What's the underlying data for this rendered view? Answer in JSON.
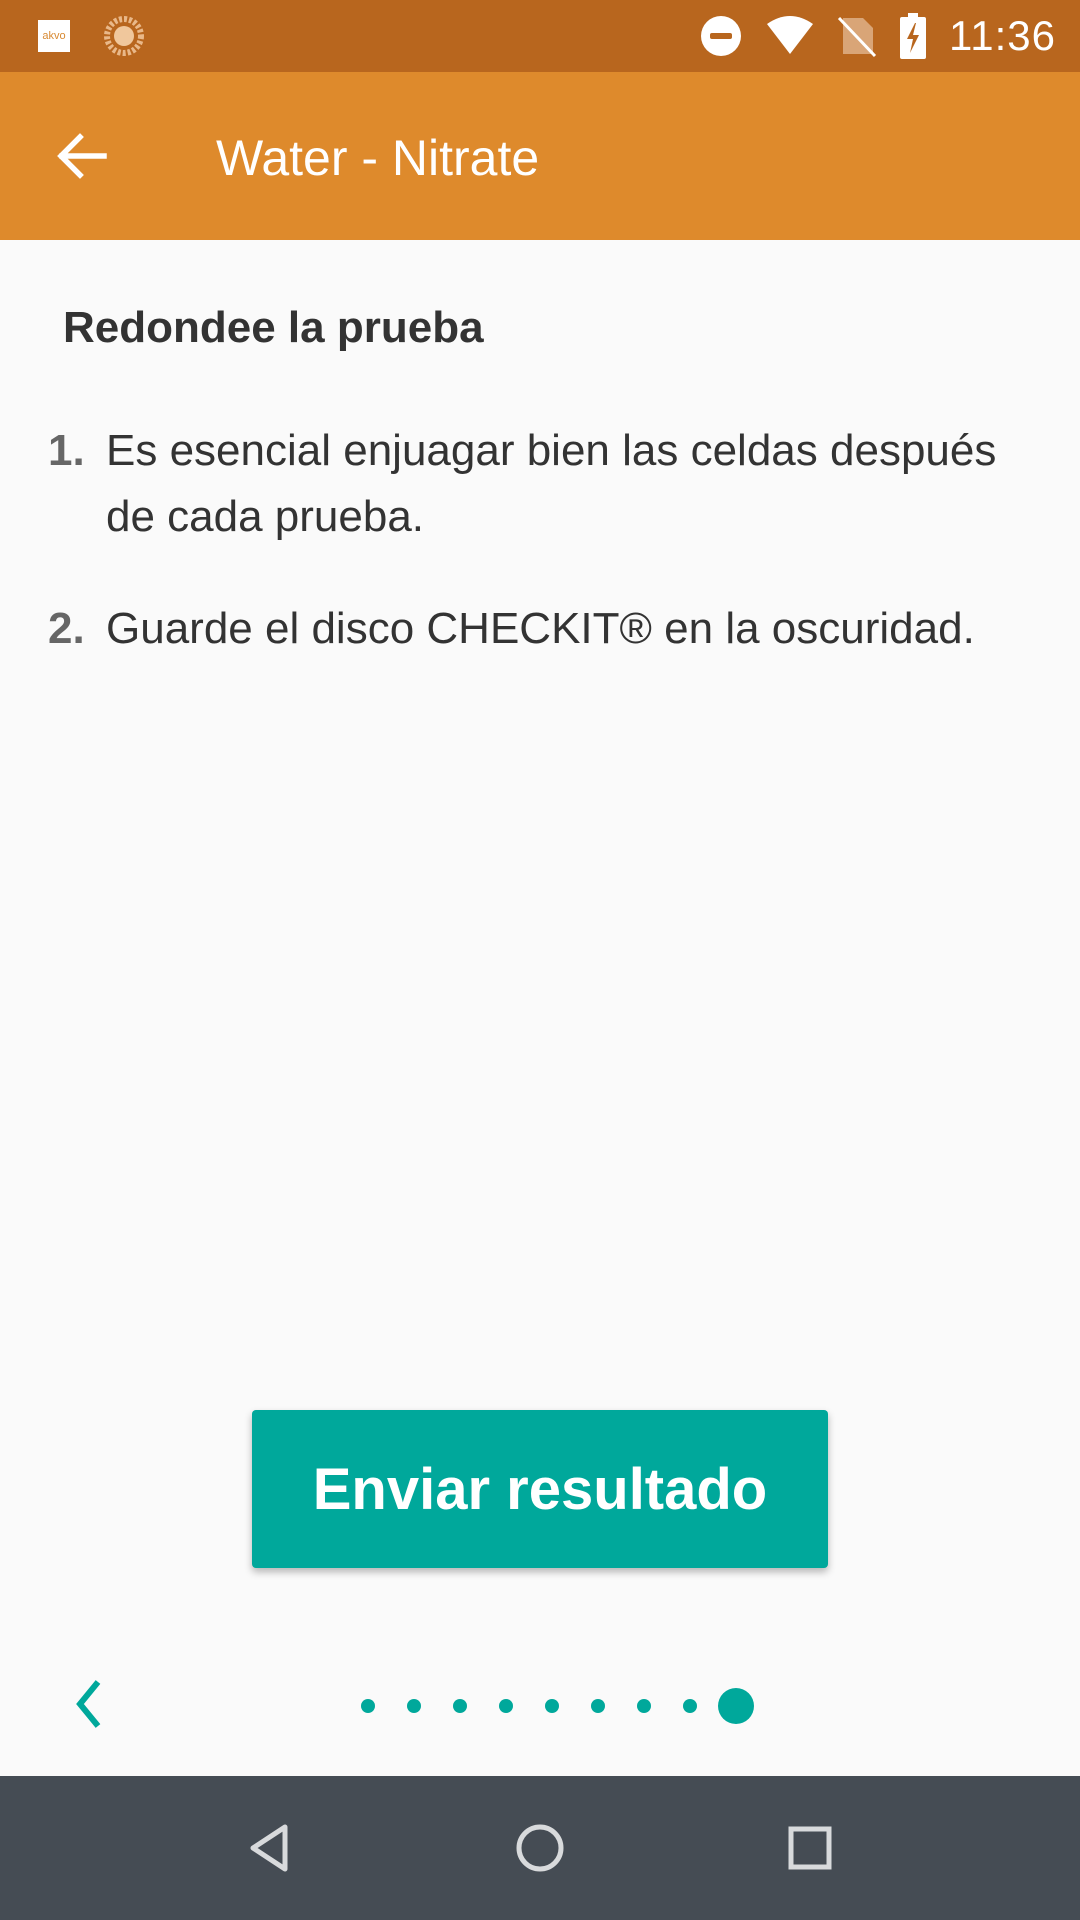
{
  "status_bar": {
    "app_icon_label": "akvo",
    "time": "11:36",
    "icons": [
      "akvo-app-icon",
      "sync-icon",
      "do-not-disturb-icon",
      "wifi-icon",
      "no-sim-icon",
      "battery-charging-icon"
    ]
  },
  "toolbar": {
    "title": "Water - Nitrate",
    "back_icon": "arrow-back-icon"
  },
  "content": {
    "heading": "Redondee la prueba",
    "steps": [
      {
        "number": "1.",
        "text": "Es esencial enjuagar bien las celdas después de cada prueba."
      },
      {
        "number": "2.",
        "text": "Guarde el disco CHECKIT® en la oscuridad."
      }
    ]
  },
  "submit_button": {
    "label": "Enviar resultado"
  },
  "pager": {
    "total_pages": 9,
    "current_page": 9,
    "prev_icon": "chevron-left-icon"
  },
  "nav_bar": {
    "icons": [
      "nav-back-icon",
      "nav-home-icon",
      "nav-recents-icon"
    ]
  },
  "colors": {
    "status_bar": "#b8661e",
    "toolbar": "#de8a2c",
    "accent": "#00a89b",
    "nav_bar": "#454c54",
    "background": "#fafafa"
  }
}
